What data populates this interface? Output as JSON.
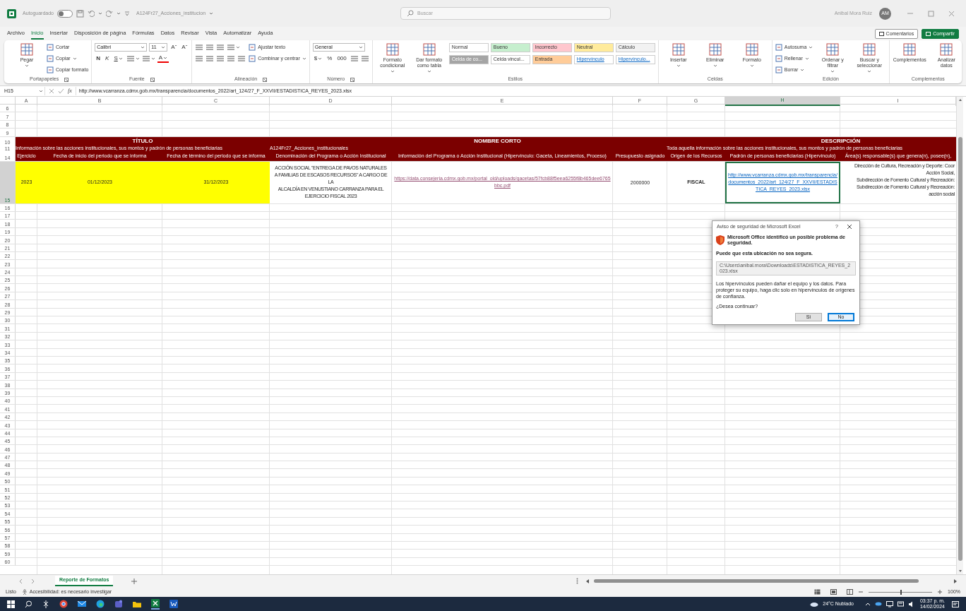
{
  "title_bar": {
    "autosave_label": "Autoguardado",
    "autosave_on": false,
    "file_name": "A124Fr27_Acciones_institucion",
    "search_placeholder": "Buscar",
    "user_name": "Anibal Mora Ruiz",
    "user_initials": "AM"
  },
  "menu_tabs": [
    {
      "label": "Archivo",
      "selected": false
    },
    {
      "label": "Inicio",
      "selected": true
    },
    {
      "label": "Insertar",
      "selected": false
    },
    {
      "label": "Disposición de página",
      "selected": false
    },
    {
      "label": "Fórmulas",
      "selected": false
    },
    {
      "label": "Datos",
      "selected": false
    },
    {
      "label": "Revisar",
      "selected": false
    },
    {
      "label": "Vista",
      "selected": false
    },
    {
      "label": "Automatizar",
      "selected": false
    },
    {
      "label": "Ayuda",
      "selected": false
    }
  ],
  "menu_actions": [
    {
      "label": "Comentarios",
      "kind": "outline"
    },
    {
      "label": "Compartir",
      "kind": "primary"
    }
  ],
  "ribbon_groups": [
    {
      "label": "Portapapeles",
      "launcher": true,
      "columns": [
        [
          {
            "kind": "large",
            "label": "Pegar",
            "dropdown": true
          }
        ],
        [
          {
            "kind": "small",
            "label": "Cortar",
            "dropdown": false
          },
          {
            "kind": "small",
            "label": "Copiar",
            "dropdown": true
          },
          {
            "kind": "small",
            "label": "Copiar formato",
            "dropdown": false
          }
        ]
      ]
    },
    {
      "label": "Fuente",
      "launcher": true,
      "columns": [
        [
          {
            "kind": "row",
            "items": [
              {
                "kind": "combo",
                "value": "Calibri"
              },
              {
                "kind": "spin",
                "value": "11"
              },
              {
                "kind": "glyph",
                "text": "Aˆ",
                "dropdown": false
              },
              {
                "kind": "glyph",
                "text": "Aˇ",
                "dropdown": false
              }
            ]
          },
          {
            "kind": "row",
            "items": [
              {
                "kind": "bold",
                "text": "N",
                "dropdown": false
              },
              {
                "kind": "italic",
                "text": "K",
                "dropdown": false
              },
              {
                "kind": "underline",
                "text": "S",
                "dropdown": true
              },
              {
                "kind": "icon",
                "dropdown": true
              },
              {
                "kind": "icon",
                "dropdown": true
              },
              {
                "kind": "colorline",
                "text": "A",
                "dropdown": true
              }
            ]
          }
        ]
      ]
    },
    {
      "label": "Alineación",
      "launcher": true,
      "columns": [
        [
          {
            "kind": "row",
            "items": [
              {
                "kind": "icon",
                "dropdown": false
              },
              {
                "kind": "icon",
                "dropdown": false
              },
              {
                "kind": "icon",
                "dropdown": false
              },
              {
                "kind": "icon",
                "dropdown": true
              }
            ]
          },
          {
            "kind": "row",
            "items": [
              {
                "kind": "icon",
                "dropdown": false
              },
              {
                "kind": "icon",
                "dropdown": false
              },
              {
                "kind": "icon",
                "dropdown": false
              },
              {
                "kind": "icon",
                "dropdown": false
              },
              {
                "kind": "icon",
                "dropdown": false
              }
            ]
          }
        ],
        [
          {
            "kind": "small",
            "label": "Ajustar texto",
            "dropdown": false
          },
          {
            "kind": "small",
            "label": "Combinar y centrar",
            "dropdown": true
          }
        ]
      ]
    },
    {
      "label": "Número",
      "launcher": true,
      "columns": [
        [
          {
            "kind": "row",
            "items": [
              {
                "kind": "combo",
                "value": "General"
              }
            ]
          },
          {
            "kind": "row",
            "items": [
              {
                "kind": "glyph",
                "text": "$",
                "dropdown": true
              },
              {
                "kind": "glyph",
                "text": "%",
                "dropdown": false
              },
              {
                "kind": "glyph",
                "text": "000",
                "dropdown": false
              },
              {
                "kind": "icon",
                "dropdown": false
              },
              {
                "kind": "icon",
                "dropdown": false
              }
            ]
          }
        ]
      ]
    },
    {
      "label": "Estilos",
      "launcher": false,
      "columns": [
        [
          {
            "kind": "large",
            "label": "Formato condicional",
            "dropdown": true
          }
        ],
        [
          {
            "kind": "large",
            "label": "Dar formato como tabla",
            "dropdown": true
          }
        ],
        [
          {
            "kind": "row",
            "items": [
              {
                "kind": "style",
                "label": "Normal",
                "color": "#ffffff",
                "link": false
              },
              {
                "kind": "style",
                "label": "Bueno",
                "color": "#c6efce",
                "link": false
              },
              {
                "kind": "style",
                "label": "Incorrecto",
                "color": "#ffc7ce",
                "link": false
              },
              {
                "kind": "style",
                "label": "Neutral",
                "color": "#ffeb9c",
                "link": false
              },
              {
                "kind": "style",
                "label": "Cálculo",
                "color": "#f2f2f2",
                "link": false
              }
            ]
          },
          {
            "kind": "row",
            "items": [
              {
                "kind": "style",
                "label": "Celda de co...",
                "color": "#a5a5a5",
                "link": false
              },
              {
                "kind": "style",
                "label": "Celda vincul...",
                "color": "#ffffff",
                "link": false
              },
              {
                "kind": "style",
                "label": "Entrada",
                "color": "#ffcc99",
                "link": false
              },
              {
                "kind": "style",
                "label": "Hipervínculo",
                "color": "#ffffff",
                "link": true
              },
              {
                "kind": "style",
                "label": "Hipervínculo...",
                "color": "#ffffff",
                "link": true
              }
            ]
          }
        ]
      ]
    },
    {
      "label": "Celdas",
      "launcher": false,
      "columns": [
        [
          {
            "kind": "large",
            "label": "Insertar",
            "dropdown": true
          }
        ],
        [
          {
            "kind": "large",
            "label": "Eliminar",
            "dropdown": true
          }
        ],
        [
          {
            "kind": "large",
            "label": "Formato",
            "dropdown": true
          }
        ]
      ]
    },
    {
      "label": "Edición",
      "launcher": false,
      "columns": [
        [
          {
            "kind": "small",
            "label": "Autosuma",
            "dropdown": true
          },
          {
            "kind": "small",
            "label": "Rellenar",
            "dropdown": true
          },
          {
            "kind": "small",
            "label": "Borrar",
            "dropdown": true
          }
        ],
        [
          {
            "kind": "large",
            "label": "Ordenar y filtrar",
            "dropdown": true
          }
        ],
        [
          {
            "kind": "large",
            "label": "Buscar y seleccionar",
            "dropdown": true
          }
        ]
      ]
    },
    {
      "label": "Complementos",
      "launcher": false,
      "columns": [
        [
          {
            "kind": "large",
            "label": "Complementos",
            "dropdown": false
          }
        ],
        [
          {
            "kind": "large",
            "label": "Analizar datos",
            "dropdown": false
          }
        ]
      ]
    }
  ],
  "formula_bar": {
    "cell_ref": "H15",
    "function_label": "fx",
    "formula": "http://www.vcarranza.cdmx.gob.mx/transparencia/documentos_2022/art_124/27_F_XXVII/ESTADISTICA_REYES_2023.xlsx"
  },
  "sheet": {
    "columns": [
      {
        "label": "A",
        "selected": false
      },
      {
        "label": "B",
        "selected": false
      },
      {
        "label": "C",
        "selected": false
      },
      {
        "label": "D",
        "selected": false
      },
      {
        "label": "E",
        "selected": false
      },
      {
        "label": "F",
        "selected": false
      },
      {
        "label": "G",
        "selected": false
      },
      {
        "label": "H",
        "selected": true
      },
      {
        "label": "I",
        "selected": false
      }
    ],
    "rows": [
      {
        "number": "6",
        "kind": "blank",
        "selected": false
      },
      {
        "number": "7",
        "kind": "blank",
        "selected": false
      },
      {
        "number": "8",
        "kind": "blank",
        "selected": false
      },
      {
        "number": "9",
        "kind": "blank",
        "selected": false
      },
      {
        "number": "10",
        "kind": "title",
        "selected": false,
        "cells": [
          {
            "kind": "heading",
            "text": "TÍTULO"
          },
          {
            "kind": "heading",
            "text": "NOMBRE CORTO"
          },
          {
            "kind": "heading",
            "text": "DESCRIPCIÓN"
          }
        ]
      },
      {
        "number": "11",
        "kind": "subtitle",
        "selected": false,
        "cells": [
          {
            "kind": "text",
            "text": "Información sobre las acciones institucionales, sus montos y padrón de personas beneficiarias"
          },
          {
            "kind": "text",
            "text": "A124Fr27_Acciones_institucionales"
          },
          {
            "kind": "centered",
            "text": "Toda aquella información sobre las acciones institucionales, sus montos y padrón de personas beneficiarias"
          }
        ]
      },
      {
        "number": "14",
        "kind": "labels",
        "selected": false,
        "cells": [
          {
            "kind": "centered",
            "text": "Ejercicio"
          },
          {
            "kind": "centered",
            "text": "Fecha de inicio del periodo que se informa"
          },
          {
            "kind": "centered",
            "text": "Fecha de término del periodo que se informa"
          },
          {
            "kind": "centered",
            "text": "Denominación del Programa o Acción Institucional"
          },
          {
            "kind": "centered",
            "text": "Información del Programa o Acción Institucional (Hipervínculo: Gaceta, Lineamientos, Proceso)"
          },
          {
            "kind": "centered",
            "text": "Presupuesto asignado"
          },
          {
            "kind": "centered",
            "text": "Origen de los Recursos"
          },
          {
            "kind": "centered",
            "text": "Padrón de personas beneficiarias (Hipervínculo)"
          },
          {
            "kind": "centered",
            "text": "Área(s) responsable(s) que genera(n), posee(n),"
          }
        ]
      },
      {
        "number": "15",
        "kind": "data",
        "selected": true,
        "cells": [
          {
            "kind": "highlight",
            "text": "2023",
            "selected": false
          },
          {
            "kind": "highlight",
            "text": "01/12/2023",
            "selected": false
          },
          {
            "kind": "highlight",
            "text": "31/12/2023",
            "selected": false
          },
          {
            "kind": "multiline",
            "text": "ACCIÓN SOCIAL \"ENTREGA DE PAVOS NATURALES\nA FAMILIAS DE ESCASOS RECURSOS\" A CARGO DE\nLA\nALCALDÍA EN VENUSTIANO CARRANZA PARA EL\nEJERCICIO FISCAL 2023",
            "selected": false
          },
          {
            "kind": "link",
            "visited": true,
            "text": "https://data.consejeria.cdmx.gob.mx/portal_old/uploads/gacetas/57fcb88f5eea6255f8b465dee6765bbc.pdf",
            "selected": false
          },
          {
            "kind": "centered",
            "text": "2000000",
            "selected": false
          },
          {
            "kind": "bold",
            "text": "FISCAL",
            "selected": false
          },
          {
            "kind": "link",
            "visited": false,
            "text": "http://www.vcarranza.cdmx.gob.mx/transparencia/documentos_2022/art_124/27_F_XXVII/ESTADISTICA_REYES_2023.xlsx",
            "selected": true
          },
          {
            "kind": "right",
            "text": "Dirección de Cultura, Recreación y Deporte: Coor\nAcción Social,\nSubdirección de Fomento Cultural y Recreación:\nSubdirección de Fomento Cultural y Recreación:\nacción social",
            "selected": false
          }
        ]
      },
      {
        "number": "16",
        "kind": "blank",
        "selected": false
      },
      {
        "number": "17",
        "kind": "blank",
        "selected": false
      },
      {
        "number": "18",
        "kind": "blank",
        "selected": false
      },
      {
        "number": "19",
        "kind": "blank",
        "selected": false
      },
      {
        "number": "20",
        "kind": "blank",
        "selected": false
      },
      {
        "number": "21",
        "kind": "blank",
        "selected": false
      },
      {
        "number": "22",
        "kind": "blank",
        "selected": false
      },
      {
        "number": "23",
        "kind": "blank",
        "selected": false
      },
      {
        "number": "24",
        "kind": "blank",
        "selected": false
      },
      {
        "number": "25",
        "kind": "blank",
        "selected": false
      },
      {
        "number": "26",
        "kind": "blank",
        "selected": false
      },
      {
        "number": "27",
        "kind": "blank",
        "selected": false
      },
      {
        "number": "28",
        "kind": "blank",
        "selected": false
      },
      {
        "number": "29",
        "kind": "blank",
        "selected": false
      },
      {
        "number": "30",
        "kind": "blank",
        "selected": false
      },
      {
        "number": "31",
        "kind": "blank",
        "selected": false
      },
      {
        "number": "32",
        "kind": "blank",
        "selected": false
      },
      {
        "number": "33",
        "kind": "blank",
        "selected": false
      },
      {
        "number": "34",
        "kind": "blank",
        "selected": false
      },
      {
        "number": "35",
        "kind": "blank",
        "selected": false
      },
      {
        "number": "36",
        "kind": "blank",
        "selected": false
      },
      {
        "number": "37",
        "kind": "blank",
        "selected": false
      },
      {
        "number": "38",
        "kind": "blank",
        "selected": false
      },
      {
        "number": "39",
        "kind": "blank",
        "selected": false
      },
      {
        "number": "40",
        "kind": "blank",
        "selected": false
      },
      {
        "number": "41",
        "kind": "blank",
        "selected": false
      },
      {
        "number": "42",
        "kind": "blank",
        "selected": false
      },
      {
        "number": "43",
        "kind": "blank",
        "selected": false
      },
      {
        "number": "44",
        "kind": "blank",
        "selected": false
      },
      {
        "number": "45",
        "kind": "blank",
        "selected": false
      },
      {
        "number": "46",
        "kind": "blank",
        "selected": false
      },
      {
        "number": "47",
        "kind": "blank",
        "selected": false
      },
      {
        "number": "48",
        "kind": "blank",
        "selected": false
      },
      {
        "number": "49",
        "kind": "blank",
        "selected": false
      },
      {
        "number": "50",
        "kind": "blank",
        "selected": false
      },
      {
        "number": "51",
        "kind": "blank",
        "selected": false
      },
      {
        "number": "52",
        "kind": "blank",
        "selected": false
      },
      {
        "number": "53",
        "kind": "blank",
        "selected": false
      },
      {
        "number": "54",
        "kind": "blank",
        "selected": false
      },
      {
        "number": "55",
        "kind": "blank",
        "selected": false
      },
      {
        "number": "56",
        "kind": "blank",
        "selected": false
      },
      {
        "number": "57",
        "kind": "blank",
        "selected": false
      },
      {
        "number": "58",
        "kind": "blank",
        "selected": false
      },
      {
        "number": "59",
        "kind": "blank",
        "selected": false
      },
      {
        "number": "60",
        "kind": "blank",
        "selected": false
      }
    ]
  },
  "dialog": {
    "title": "Aviso de seguridad de Microsoft Excel",
    "help": "?",
    "heading": "Microsoft Office identificó un posible problema de seguridad.",
    "warning": "Puede que esta ubicación no sea segura.",
    "path": "C:\\Users\\anibal.mora\\Downloads\\ESTADISTICA_REYES_2023.xlsx",
    "message": "Los hipervínculos pueden dañar el equipo y los datos. Para proteger su equipo, haga clic solo en hipervínculos de orígenes de confianza.",
    "question": "¿Desea continuar?",
    "buttons": [
      {
        "label": "Sí",
        "selected": false
      },
      {
        "label": "No",
        "selected": true
      }
    ]
  },
  "sheet_tabs": [
    {
      "label": "Reporte de Formatos",
      "selected": true
    }
  ],
  "status_bar": {
    "mode": "Listo",
    "accessibility": "Accesibilidad: es necesario investigar",
    "zoom_slider": {
      "level": 0.5
    },
    "zoom": "100%"
  },
  "taskbar": {
    "weather": "24°C Nublado",
    "time": "03:37 p. m.",
    "date": "14/02/2024"
  }
}
